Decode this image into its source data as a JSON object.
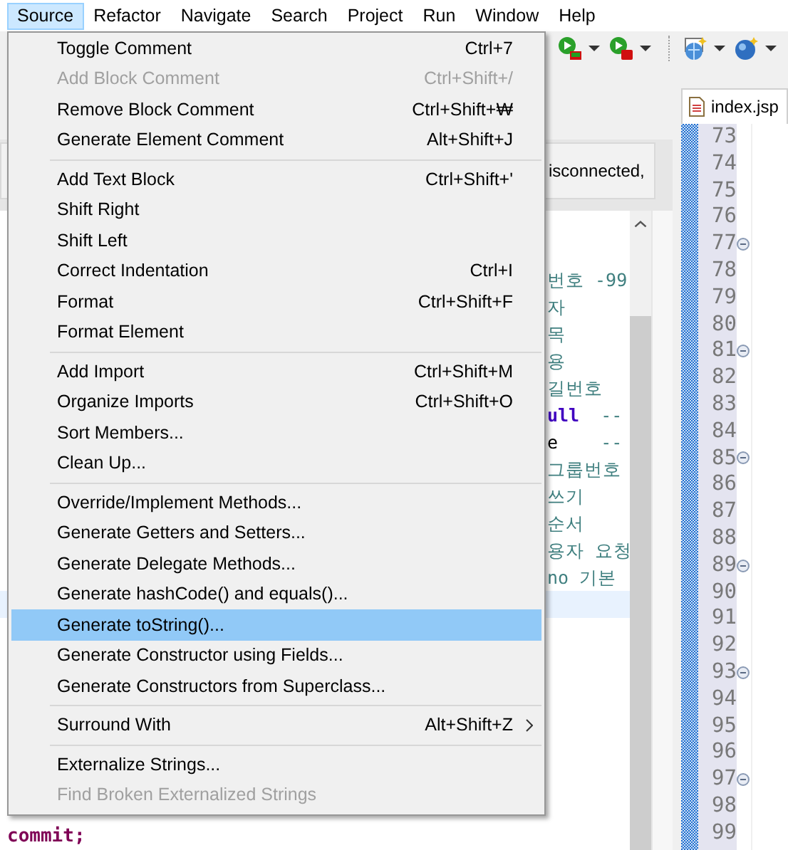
{
  "menubar": [
    {
      "label": "Source",
      "selected": true
    },
    {
      "label": "Refactor",
      "selected": false
    },
    {
      "label": "Navigate",
      "selected": false
    },
    {
      "label": "Search",
      "selected": false
    },
    {
      "label": "Project",
      "selected": false
    },
    {
      "label": "Run",
      "selected": false
    },
    {
      "label": "Window",
      "selected": false
    },
    {
      "label": "Help",
      "selected": false
    }
  ],
  "menu": {
    "groups": [
      [
        {
          "label": "Toggle Comment",
          "shortcut": "Ctrl+7",
          "disabled": false,
          "selected": false
        },
        {
          "label": "Add Block Comment",
          "shortcut": "Ctrl+Shift+/",
          "disabled": true,
          "selected": false
        },
        {
          "label": "Remove Block Comment",
          "shortcut": "Ctrl+Shift+₩",
          "disabled": false,
          "selected": false
        },
        {
          "label": "Generate Element Comment",
          "shortcut": "Alt+Shift+J",
          "disabled": false,
          "selected": false
        }
      ],
      [
        {
          "label": "Add Text Block",
          "shortcut": "Ctrl+Shift+'",
          "disabled": false,
          "selected": false
        },
        {
          "label": "Shift Right",
          "disabled": false,
          "selected": false
        },
        {
          "label": "Shift Left",
          "disabled": false,
          "selected": false
        },
        {
          "label": "Correct Indentation",
          "shortcut": "Ctrl+I",
          "disabled": false,
          "selected": false
        },
        {
          "label": "Format",
          "shortcut": "Ctrl+Shift+F",
          "disabled": false,
          "selected": false
        },
        {
          "label": "Format Element",
          "disabled": false,
          "selected": false
        }
      ],
      [
        {
          "label": "Add Import",
          "shortcut": "Ctrl+Shift+M",
          "disabled": false,
          "selected": false
        },
        {
          "label": "Organize Imports",
          "shortcut": "Ctrl+Shift+O",
          "disabled": false,
          "selected": false
        },
        {
          "label": "Sort Members...",
          "disabled": false,
          "selected": false
        },
        {
          "label": "Clean Up...",
          "disabled": false,
          "selected": false
        }
      ],
      [
        {
          "label": "Override/Implement Methods...",
          "disabled": false,
          "selected": false
        },
        {
          "label": "Generate Getters and Setters...",
          "disabled": false,
          "selected": false
        },
        {
          "label": "Generate Delegate Methods...",
          "disabled": false,
          "selected": false
        },
        {
          "label": "Generate hashCode() and equals()...",
          "disabled": false,
          "selected": false
        },
        {
          "label": "Generate toString()...",
          "disabled": false,
          "selected": true
        },
        {
          "label": "Generate Constructor using Fields...",
          "disabled": false,
          "selected": false
        },
        {
          "label": "Generate Constructors from Superclass...",
          "disabled": false,
          "selected": false
        }
      ],
      [
        {
          "label": "Surround With",
          "shortcut": "Alt+Shift+Z",
          "submenu": true,
          "disabled": false,
          "selected": false
        }
      ],
      [
        {
          "label": "Externalize Strings...",
          "disabled": false,
          "selected": false
        },
        {
          "label": "Find Broken Externalized Strings",
          "disabled": true,
          "selected": false
        }
      ]
    ]
  },
  "left_editor": {
    "message": "isconnected,",
    "lines": [
      {
        "current": false,
        "segments": [
          {
            "text": "번호 -99",
            "kind": "comment"
          }
        ]
      },
      {
        "current": false,
        "segments": [
          {
            "text": "자",
            "kind": "comment"
          }
        ]
      },
      {
        "current": false,
        "segments": [
          {
            "text": "목",
            "kind": "comment"
          }
        ]
      },
      {
        "current": false,
        "segments": [
          {
            "text": "용",
            "kind": "comment"
          }
        ]
      },
      {
        "current": false,
        "segments": [
          {
            "text": "길번호",
            "kind": "comment"
          }
        ]
      },
      {
        "current": false,
        "segments": [
          {
            "text": "ull",
            "kind": "keyword"
          },
          {
            "text": "  --",
            "kind": "comment"
          }
        ]
      },
      {
        "current": false,
        "segments": [
          {
            "text": "e",
            "kind": "plain"
          },
          {
            "text": "    --",
            "kind": "comment"
          }
        ]
      },
      {
        "current": false,
        "segments": [
          {
            "text": "그룹번호",
            "kind": "comment"
          }
        ]
      },
      {
        "current": false,
        "segments": [
          {
            "text": "쓰기",
            "kind": "comment"
          }
        ]
      },
      {
        "current": false,
        "segments": [
          {
            "text": "순서",
            "kind": "comment"
          }
        ]
      },
      {
        "current": false,
        "segments": [
          {
            "text": "용자 요청",
            "kind": "comment"
          }
        ]
      },
      {
        "current": false,
        "segments": [
          {
            "text": "no 기본",
            "kind": "comment"
          }
        ]
      },
      {
        "current": true
      }
    ],
    "last_line": {
      "text": "commit;",
      "kind": "keyword"
    }
  },
  "right_editor": {
    "tab": "index.jsp",
    "line_numbers": [
      {
        "number": "73",
        "foldable": false
      },
      {
        "number": "74",
        "foldable": false
      },
      {
        "number": "75",
        "foldable": false
      },
      {
        "number": "76",
        "foldable": false
      },
      {
        "number": "77",
        "foldable": true
      },
      {
        "number": "78",
        "foldable": false
      },
      {
        "number": "79",
        "foldable": false
      },
      {
        "number": "80",
        "foldable": false
      },
      {
        "number": "81",
        "foldable": true
      },
      {
        "number": "82",
        "foldable": false
      },
      {
        "number": "83",
        "foldable": false
      },
      {
        "number": "84",
        "foldable": false
      },
      {
        "number": "85",
        "foldable": true
      },
      {
        "number": "86",
        "foldable": false
      },
      {
        "number": "87",
        "foldable": false
      },
      {
        "number": "88",
        "foldable": false
      },
      {
        "number": "89",
        "foldable": true
      },
      {
        "number": "90",
        "foldable": false
      },
      {
        "number": "91",
        "foldable": false
      },
      {
        "number": "92",
        "foldable": false
      },
      {
        "number": "93",
        "foldable": true
      },
      {
        "number": "94",
        "foldable": false
      },
      {
        "number": "95",
        "foldable": false
      },
      {
        "number": "96",
        "foldable": false
      },
      {
        "number": "97",
        "foldable": true
      },
      {
        "number": "98",
        "foldable": false
      },
      {
        "number": "99",
        "foldable": false
      }
    ]
  }
}
